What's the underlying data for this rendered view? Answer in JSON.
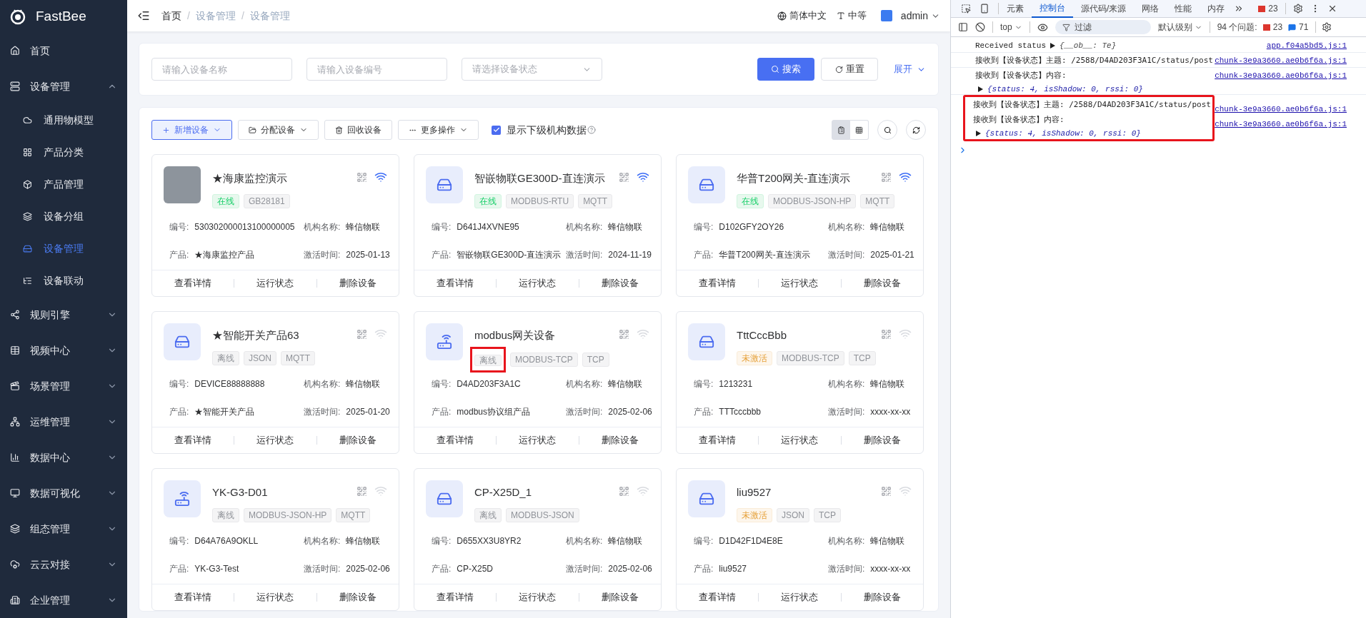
{
  "sidebar": {
    "logo": "FastBee",
    "items": [
      {
        "label": "首页"
      },
      {
        "label": "设备管理",
        "expanded": true,
        "children": [
          {
            "label": "通用物模型",
            "selected": false
          },
          {
            "label": "产品分类",
            "selected": false
          },
          {
            "label": "产品管理",
            "selected": false
          },
          {
            "label": "设备分组",
            "selected": false
          },
          {
            "label": "设备管理",
            "selected": true
          },
          {
            "label": "设备联动",
            "selected": false
          }
        ]
      },
      {
        "label": "规则引擎",
        "expanded": false
      },
      {
        "label": "视频中心",
        "expanded": false
      },
      {
        "label": "场景管理",
        "expanded": false
      },
      {
        "label": "运维管理",
        "expanded": false
      },
      {
        "label": "数据中心",
        "expanded": false
      },
      {
        "label": "数据可视化",
        "expanded": false
      },
      {
        "label": "组态管理",
        "expanded": false
      },
      {
        "label": "云云对接",
        "expanded": false
      },
      {
        "label": "企业管理",
        "expanded": false
      }
    ]
  },
  "header": {
    "breadcrumb": [
      "首页",
      "设备管理",
      "设备管理"
    ],
    "separator": "/",
    "language": "简体中文",
    "size": "中等",
    "user": "admin"
  },
  "search": {
    "fields": [
      {
        "kind": "input",
        "placeholder": "请输入设备名称"
      },
      {
        "kind": "input",
        "placeholder": "请输入设备编号"
      },
      {
        "kind": "select",
        "placeholder": "请选择设备状态"
      }
    ],
    "search_button": "搜索",
    "reset_button": "重置",
    "expand_link": "展开"
  },
  "toolbar": {
    "buttons": [
      {
        "kind": "primary",
        "label": "新增设备"
      },
      {
        "kind": "assign",
        "label": "分配设备"
      },
      {
        "kind": "recycle",
        "label": "回收设备"
      },
      {
        "kind": "more",
        "label": "更多操作"
      }
    ],
    "checkbox": {
      "label": "显示下级机构数据",
      "checked": true
    },
    "views": [
      {
        "kind": "card",
        "selected": true
      },
      {
        "kind": "grid",
        "selected": false
      }
    ]
  },
  "cards": [
    {
      "kind": "photo",
      "name": "★海康监控演示",
      "status": {
        "kind": "online",
        "label": "在线",
        "highlighted": false
      },
      "tags": [
        "GB28181"
      ],
      "fields": [
        {
          "label": "编号:",
          "value": "530302000013100000005"
        },
        {
          "label": "机构名称:",
          "value": "蜂信物联"
        },
        {
          "label": "产品:",
          "value": "★海康监控产品"
        },
        {
          "label": "激活时间:",
          "value": "2025-01-13"
        }
      ],
      "actions": [
        "查看详情",
        "运行状态",
        "删除设备"
      ]
    },
    {
      "kind": "gateway",
      "name": "智嵌物联GE300D-直连演示",
      "status": {
        "kind": "online",
        "label": "在线",
        "highlighted": false
      },
      "tags": [
        "MODBUS-RTU",
        "MQTT"
      ],
      "fields": [
        {
          "label": "编号:",
          "value": "D641J4XVNE95"
        },
        {
          "label": "机构名称:",
          "value": "蜂信物联"
        },
        {
          "label": "产品:",
          "value": "智嵌物联GE300D-直连演示"
        },
        {
          "label": "激活时间:",
          "value": "2024-11-19"
        }
      ],
      "actions": [
        "查看详情",
        "运行状态",
        "删除设备"
      ]
    },
    {
      "kind": "gateway",
      "name": "华普T200网关-直连演示",
      "status": {
        "kind": "online",
        "label": "在线",
        "highlighted": false
      },
      "tags": [
        "MODBUS-JSON-HP",
        "MQTT"
      ],
      "fields": [
        {
          "label": "编号:",
          "value": "D102GFY2OY26"
        },
        {
          "label": "机构名称:",
          "value": "蜂信物联"
        },
        {
          "label": "产品:",
          "value": "华普T200网关-直连演示"
        },
        {
          "label": "激活时间:",
          "value": "2025-01-21"
        }
      ],
      "actions": [
        "查看详情",
        "运行状态",
        "删除设备"
      ]
    },
    {
      "kind": "gateway",
      "name": "★智能开关产品63",
      "status": {
        "kind": "offline",
        "label": "离线",
        "highlighted": false
      },
      "tags": [
        "JSON",
        "MQTT"
      ],
      "fields": [
        {
          "label": "编号:",
          "value": "DEVICE88888888"
        },
        {
          "label": "机构名称:",
          "value": "蜂信物联"
        },
        {
          "label": "产品:",
          "value": "★智能开关产品"
        },
        {
          "label": "激活时间:",
          "value": "2025-01-20"
        }
      ],
      "actions": [
        "查看详情",
        "运行状态",
        "删除设备"
      ]
    },
    {
      "kind": "router",
      "name": "modbus网关设备",
      "status": {
        "kind": "offline",
        "label": "离线",
        "highlighted": true
      },
      "tags": [
        "MODBUS-TCP",
        "TCP"
      ],
      "fields": [
        {
          "label": "编号:",
          "value": "D4AD203F3A1C"
        },
        {
          "label": "机构名称:",
          "value": "蜂信物联"
        },
        {
          "label": "产品:",
          "value": "modbus协议组产品"
        },
        {
          "label": "激活时间:",
          "value": "2025-02-06"
        }
      ],
      "actions": [
        "查看详情",
        "运行状态",
        "删除设备"
      ]
    },
    {
      "kind": "gateway",
      "name": "TttCccBbb",
      "status": {
        "kind": "inactive",
        "label": "未激活",
        "highlighted": false
      },
      "tags": [
        "MODBUS-TCP",
        "TCP"
      ],
      "fields": [
        {
          "label": "编号:",
          "value": "1213231"
        },
        {
          "label": "机构名称:",
          "value": "蜂信物联"
        },
        {
          "label": "产品:",
          "value": "TTTcccbbb"
        },
        {
          "label": "激活时间:",
          "value": "xxxx-xx-xx"
        }
      ],
      "actions": [
        "查看详情",
        "运行状态",
        "删除设备"
      ]
    },
    {
      "kind": "router",
      "name": "YK-G3-D01",
      "status": {
        "kind": "offline",
        "label": "离线",
        "highlighted": false
      },
      "tags": [
        "MODBUS-JSON-HP",
        "MQTT"
      ],
      "fields": [
        {
          "label": "编号:",
          "value": "D64A76A9OKLL"
        },
        {
          "label": "机构名称:",
          "value": "蜂信物联"
        },
        {
          "label": "产品:",
          "value": "YK-G3-Test"
        },
        {
          "label": "激活时间:",
          "value": "2025-02-06"
        }
      ],
      "actions": [
        "查看详情",
        "运行状态",
        "删除设备"
      ]
    },
    {
      "kind": "gateway",
      "name": "CP-X25D_1",
      "status": {
        "kind": "offline",
        "label": "离线",
        "highlighted": false
      },
      "tags": [
        "MODBUS-JSON"
      ],
      "fields": [
        {
          "label": "编号:",
          "value": "D655XX3U8YR2"
        },
        {
          "label": "机构名称:",
          "value": "蜂信物联"
        },
        {
          "label": "产品:",
          "value": "CP-X25D"
        },
        {
          "label": "激活时间:",
          "value": "2025-02-06"
        }
      ],
      "actions": [
        "查看详情",
        "运行状态",
        "删除设备"
      ]
    },
    {
      "kind": "gateway",
      "name": "liu9527",
      "status": {
        "kind": "inactive",
        "label": "未激活",
        "highlighted": false
      },
      "tags": [
        "JSON",
        "TCP"
      ],
      "fields": [
        {
          "label": "编号:",
          "value": "D1D42F1D4E8E"
        },
        {
          "label": "机构名称:",
          "value": "蜂信物联"
        },
        {
          "label": "产品:",
          "value": "liu9527"
        },
        {
          "label": "激活时间:",
          "value": "xxxx-xx-xx"
        }
      ],
      "actions": [
        "查看详情",
        "运行状态",
        "删除设备"
      ]
    }
  ],
  "devtools": {
    "tabs": [
      {
        "label": "元素",
        "selected": false
      },
      {
        "label": "控制台",
        "selected": true
      },
      {
        "label": "源代码/来源",
        "selected": false
      },
      {
        "label": "网络",
        "selected": false
      },
      {
        "label": "性能",
        "selected": false
      },
      {
        "label": "内存",
        "selected": false
      }
    ],
    "error_count": "23",
    "context": "top",
    "filter_placeholder": "过滤",
    "level": "默认级别",
    "issues_label": "94 个问题:",
    "issues_errors": "23",
    "issues_info": "71",
    "console_groups": [
      {
        "highlighted": false,
        "messages": [
          {
            "kind": "mono",
            "text": "Received status",
            "object": "{__ob__: Te}",
            "source": "app.f04a5bd5.js:1"
          },
          {
            "kind": "text",
            "text": "接收到【设备状态】主题: /2588/D4AD203F3A1C/status/post",
            "source": "chunk-3e9a3660.ae0b6f6a.js:1"
          },
          {
            "kind": "text",
            "text": "接收到【设备状态】内容:",
            "object": "{status: 4, isShadow: 0, rssi: 0}",
            "source": "chunk-3e9a3660.ae0b6f6a.js:1"
          }
        ]
      },
      {
        "highlighted": true,
        "messages": [
          {
            "kind": "text",
            "text": "接收到【设备状态】主题: /2588/D4AD203F3A1C/status/post",
            "source": "chunk-3e9a3660.ae0b6f6a.js:1"
          },
          {
            "kind": "text",
            "text": "接收到【设备状态】内容:",
            "object": "{status: 4, isShadow: 0, rssi: 0}",
            "source": "chunk-3e9a3660.ae0b6f6a.js:1"
          }
        ]
      }
    ]
  }
}
